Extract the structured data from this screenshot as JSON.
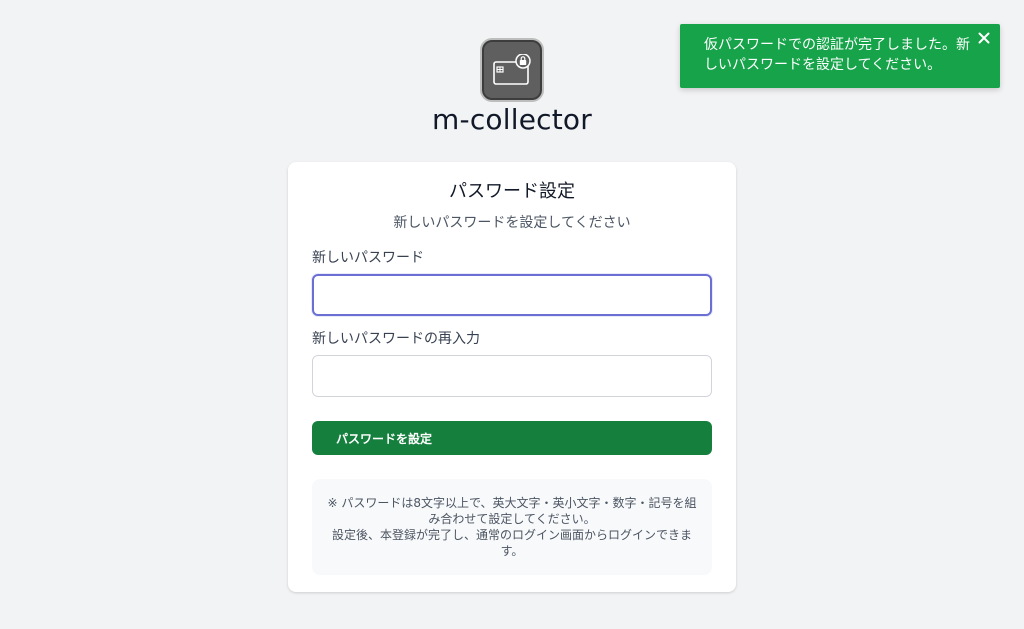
{
  "app": {
    "name": "m-collector",
    "logo_icon": "card-lock-icon"
  },
  "form": {
    "title": "パスワード設定",
    "subtitle": "新しいパスワードを設定してください",
    "new_password": {
      "label": "新しいパスワード",
      "value": "",
      "placeholder": ""
    },
    "confirm_password": {
      "label": "新しいパスワードの再入力",
      "value": "",
      "placeholder": ""
    },
    "submit_label": "パスワードを設定"
  },
  "note": {
    "line1": "※ パスワードは8文字以上で、英大文字・英小文字・数字・記号を組み合わせて設定してください。",
    "line2": "設定後、本登録が完了し、通常のログイン画面からログインできます。"
  },
  "toast": {
    "message": "仮パスワードでの認証が完了しました。新しいパスワードを設定してください。",
    "close_icon": "close-icon"
  },
  "colors": {
    "background": "#f2f3f5",
    "primary_button": "#15803d",
    "toast": "#16a34a",
    "focus_ring": "#6b6fd4"
  }
}
